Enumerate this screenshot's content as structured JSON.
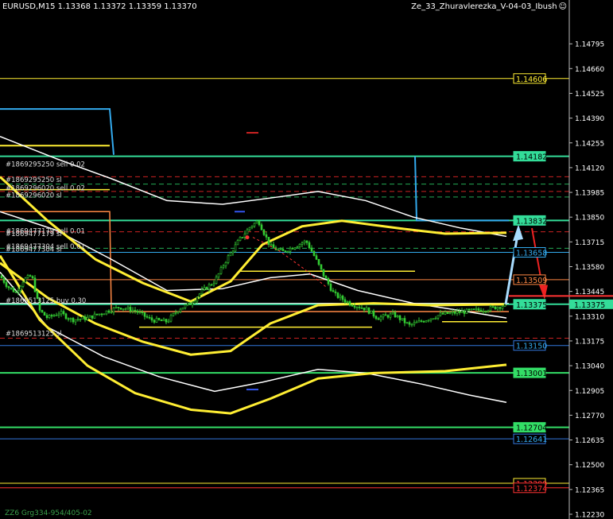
{
  "header": {
    "symbol_info": "EURUSD,M15  1.13368 1.13372 1.13359 1.13370",
    "ea_name": "Ze_33_Zhuravlerezka_V-04-03_Ibush",
    "smile_icon": "smiley-icon"
  },
  "footer": {
    "text": "ZZ6 Grg334-954/405-02"
  },
  "colors": {
    "background": "#000000",
    "candle": "#33cc33",
    "yellow": "#ffee33",
    "white": "#ffffff",
    "green_line": "#33dd66",
    "cyan": "#33aaee",
    "orange": "#ff8844",
    "red": "#ff3333"
  },
  "price_axis": {
    "min": 1.1223,
    "max": 1.1493,
    "ticks": [
      "1.14795",
      "1.14660",
      "1.14525",
      "1.14390",
      "1.14255",
      "1.14120",
      "1.13985",
      "1.13850",
      "1.13715",
      "1.13580",
      "1.13445",
      "1.13310",
      "1.13175",
      "1.13040",
      "1.12905",
      "1.12770",
      "1.12635",
      "1.12500",
      "1.12365",
      "1.12230"
    ]
  },
  "levels": [
    {
      "price": "1.14606",
      "line": "#ffee33",
      "box_border": "#ffee33",
      "text_color": "#ffee33",
      "bg": "#000000"
    },
    {
      "price": "1.14182",
      "line": "#33dd99",
      "box_border": "#33dd99",
      "text_color": "#000000",
      "bg": "#33dd99"
    },
    {
      "price": "1.13832",
      "line": "#33dd99",
      "box_border": "#33dd99",
      "text_color": "#000000",
      "bg": "#33dd99"
    },
    {
      "price": "1.13658",
      "line": "#33aaee",
      "box_border": "#33aaee",
      "text_color": "#33aaee",
      "bg": "#000000"
    },
    {
      "price": "1.13509",
      "line": "#ff8844",
      "box_border": "#ff8844",
      "text_color": "#ff8844",
      "bg": "#000000"
    },
    {
      "price": "1.13375",
      "line": "#33dd99",
      "box_border": "#33dd99",
      "text_color": "#000000",
      "bg": "#33dd99"
    },
    {
      "price": "1.13150",
      "line": "#3377dd",
      "box_border": "#3377dd",
      "text_color": "#33aaee",
      "bg": "#000000"
    },
    {
      "price": "1.13001",
      "line": "#33dd66",
      "box_border": "#33dd66",
      "text_color": "#000000",
      "bg": "#33dd66"
    },
    {
      "price": "1.12704",
      "line": "#33dd66",
      "box_border": "#33dd66",
      "text_color": "#000000",
      "bg": "#33dd66"
    },
    {
      "price": "1.12641",
      "line": "#3377dd",
      "box_border": "#3377dd",
      "text_color": "#33aaee",
      "bg": "#000000"
    },
    {
      "price": "1.12399",
      "line": "#ffee33",
      "box_border": "#ffee33",
      "text_color": "#ff3333",
      "bg": "#000000"
    },
    {
      "price": "1.12374",
      "line": "#ff3333",
      "box_border": "#ff3333",
      "text_color": "#ff3333",
      "bg": "#000000"
    }
  ],
  "current_price": {
    "price": "1.13375",
    "marker_color": "#ff3333"
  },
  "order_labels": [
    {
      "text": "#1869295250 sell 0.02",
      "price": 1.1414
    },
    {
      "text": "#1869295250 sl",
      "price": 1.14055
    },
    {
      "text": "#1869296020 sell 0.02",
      "price": 1.1401
    },
    {
      "text": "#1869296020 sl",
      "price": 1.1397
    },
    {
      "text": "#1869477179 sell 0.01",
      "price": 1.13775
    },
    {
      "text": "#1869477179 sl",
      "price": 1.1376
    },
    {
      "text": "#1869477304 sell 0.01",
      "price": 1.1369
    },
    {
      "text": "#1869477304 sl",
      "price": 1.13675
    },
    {
      "text": "#1869513125 buy 0.30",
      "price": 1.13395
    },
    {
      "text": "#1869513125 sl",
      "price": 1.13215
    }
  ],
  "chart_data": {
    "type": "candlestick",
    "symbol": "EURUSD",
    "timeframe": "M15",
    "ylim": [
      1.1223,
      1.1493
    ],
    "close_path": [
      {
        "x": 0,
        "y": 1.1353
      },
      {
        "x": 10,
        "y": 1.1347
      },
      {
        "x": 20,
        "y": 1.1344
      },
      {
        "x": 30,
        "y": 1.1351
      },
      {
        "x": 40,
        "y": 1.1353
      },
      {
        "x": 50,
        "y": 1.1334
      },
      {
        "x": 60,
        "y": 1.133
      },
      {
        "x": 75,
        "y": 1.1333
      },
      {
        "x": 90,
        "y": 1.1329
      },
      {
        "x": 110,
        "y": 1.133
      },
      {
        "x": 130,
        "y": 1.1333
      },
      {
        "x": 150,
        "y": 1.1336
      },
      {
        "x": 170,
        "y": 1.1334
      },
      {
        "x": 190,
        "y": 1.1329
      },
      {
        "x": 210,
        "y": 1.1328
      },
      {
        "x": 225,
        "y": 1.1335
      },
      {
        "x": 240,
        "y": 1.1338
      },
      {
        "x": 255,
        "y": 1.1345
      },
      {
        "x": 270,
        "y": 1.135
      },
      {
        "x": 285,
        "y": 1.1362
      },
      {
        "x": 300,
        "y": 1.1372
      },
      {
        "x": 315,
        "y": 1.138
      },
      {
        "x": 325,
        "y": 1.1383
      },
      {
        "x": 340,
        "y": 1.1369
      },
      {
        "x": 355,
        "y": 1.1366
      },
      {
        "x": 370,
        "y": 1.1369
      },
      {
        "x": 385,
        "y": 1.1372
      },
      {
        "x": 395,
        "y": 1.1364
      },
      {
        "x": 405,
        "y": 1.1355
      },
      {
        "x": 420,
        "y": 1.1343
      },
      {
        "x": 440,
        "y": 1.1338
      },
      {
        "x": 460,
        "y": 1.1335
      },
      {
        "x": 475,
        "y": 1.133
      },
      {
        "x": 495,
        "y": 1.1332
      },
      {
        "x": 515,
        "y": 1.1326
      },
      {
        "x": 535,
        "y": 1.1329
      },
      {
        "x": 555,
        "y": 1.1332
      },
      {
        "x": 575,
        "y": 1.1333
      },
      {
        "x": 595,
        "y": 1.1334
      },
      {
        "x": 615,
        "y": 1.1335
      },
      {
        "x": 635,
        "y": 1.1337
      }
    ],
    "ma_yellow_upper": [
      {
        "x": 0,
        "y": 1.1407
      },
      {
        "x": 60,
        "y": 1.1383
      },
      {
        "x": 120,
        "y": 1.1362
      },
      {
        "x": 180,
        "y": 1.1349
      },
      {
        "x": 240,
        "y": 1.1339
      },
      {
        "x": 290,
        "y": 1.135
      },
      {
        "x": 330,
        "y": 1.137
      },
      {
        "x": 380,
        "y": 1.138
      },
      {
        "x": 430,
        "y": 1.1383
      },
      {
        "x": 500,
        "y": 1.1379
      },
      {
        "x": 560,
        "y": 1.1376
      },
      {
        "x": 637,
        "y": 1.13765
      }
    ],
    "ma_yellow_middle": [
      {
        "x": 0,
        "y": 1.136
      },
      {
        "x": 60,
        "y": 1.1341
      },
      {
        "x": 120,
        "y": 1.1327
      },
      {
        "x": 180,
        "y": 1.1317
      },
      {
        "x": 240,
        "y": 1.131
      },
      {
        "x": 290,
        "y": 1.1312
      },
      {
        "x": 340,
        "y": 1.1327
      },
      {
        "x": 400,
        "y": 1.1337
      },
      {
        "x": 470,
        "y": 1.1338
      },
      {
        "x": 540,
        "y": 1.1337
      },
      {
        "x": 637,
        "y": 1.13375
      }
    ],
    "ma_yellow_lower": [
      {
        "x": 0,
        "y": 1.1364
      },
      {
        "x": 50,
        "y": 1.1329
      },
      {
        "x": 110,
        "y": 1.1304
      },
      {
        "x": 170,
        "y": 1.1289
      },
      {
        "x": 240,
        "y": 1.128
      },
      {
        "x": 290,
        "y": 1.1278
      },
      {
        "x": 340,
        "y": 1.1286
      },
      {
        "x": 400,
        "y": 1.1297
      },
      {
        "x": 470,
        "y": 1.13
      },
      {
        "x": 560,
        "y": 1.1301
      },
      {
        "x": 637,
        "y": 1.13045
      }
    ],
    "ma_white_upper": [
      {
        "x": 0,
        "y": 1.1429
      },
      {
        "x": 70,
        "y": 1.1417
      },
      {
        "x": 140,
        "y": 1.1406
      },
      {
        "x": 210,
        "y": 1.1394
      },
      {
        "x": 280,
        "y": 1.1392
      },
      {
        "x": 350,
        "y": 1.1396
      },
      {
        "x": 400,
        "y": 1.1399
      },
      {
        "x": 460,
        "y": 1.1394
      },
      {
        "x": 520,
        "y": 1.1385
      },
      {
        "x": 580,
        "y": 1.1379
      },
      {
        "x": 637,
        "y": 1.13745
      }
    ],
    "ma_white_middle": [
      {
        "x": 0,
        "y": 1.1388
      },
      {
        "x": 70,
        "y": 1.1378
      },
      {
        "x": 140,
        "y": 1.1362
      },
      {
        "x": 210,
        "y": 1.1345
      },
      {
        "x": 280,
        "y": 1.1346
      },
      {
        "x": 340,
        "y": 1.1352
      },
      {
        "x": 390,
        "y": 1.1354
      },
      {
        "x": 450,
        "y": 1.1345
      },
      {
        "x": 520,
        "y": 1.1338
      },
      {
        "x": 580,
        "y": 1.1334
      },
      {
        "x": 637,
        "y": 1.133
      }
    ],
    "ma_white_lower": [
      {
        "x": 0,
        "y": 1.1355
      },
      {
        "x": 60,
        "y": 1.1325
      },
      {
        "x": 130,
        "y": 1.1309
      },
      {
        "x": 200,
        "y": 1.1298
      },
      {
        "x": 270,
        "y": 1.129
      },
      {
        "x": 330,
        "y": 1.1295
      },
      {
        "x": 400,
        "y": 1.1302
      },
      {
        "x": 460,
        "y": 1.13
      },
      {
        "x": 530,
        "y": 1.1294
      },
      {
        "x": 590,
        "y": 1.1288
      },
      {
        "x": 637,
        "y": 1.1284
      }
    ]
  }
}
